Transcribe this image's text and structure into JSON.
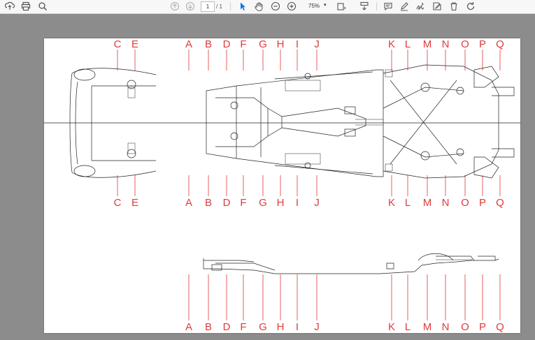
{
  "toolbar": {
    "page_current": "1",
    "page_total": "/ 1",
    "zoom": "75%",
    "colors": {
      "background": "#f7f7f7",
      "active_icon": "#1a73e8",
      "icon": "#555555"
    },
    "icons": [
      "upload-icon",
      "print-icon",
      "search-icon",
      "up-arrow-icon",
      "down-arrow-icon",
      "pointer-icon",
      "hand-icon",
      "zoom-out-icon",
      "zoom-in-icon",
      "fit-page-icon",
      "scroll-mode-icon",
      "comment-icon",
      "pen-icon",
      "sign-icon",
      "fill-form-icon",
      "delete-icon",
      "rotate-icon"
    ]
  },
  "drawing": {
    "top_labels": [
      "C",
      "E",
      "A",
      "B",
      "D",
      "F",
      "G",
      "H",
      "I",
      "J",
      "K",
      "L",
      "M",
      "N",
      "O",
      "P",
      "Q"
    ],
    "bottom_labels": [
      "C",
      "E",
      "A",
      "B",
      "D",
      "F",
      "G",
      "H",
      "I",
      "J",
      "K",
      "L",
      "M",
      "N",
      "O",
      "P",
      "Q"
    ],
    "side_labels": [
      "A",
      "B",
      "D",
      "F",
      "G",
      "H",
      "I",
      "J",
      "K",
      "L",
      "M",
      "N",
      "O",
      "P",
      "Q"
    ],
    "label_color": "#e03a3a"
  }
}
